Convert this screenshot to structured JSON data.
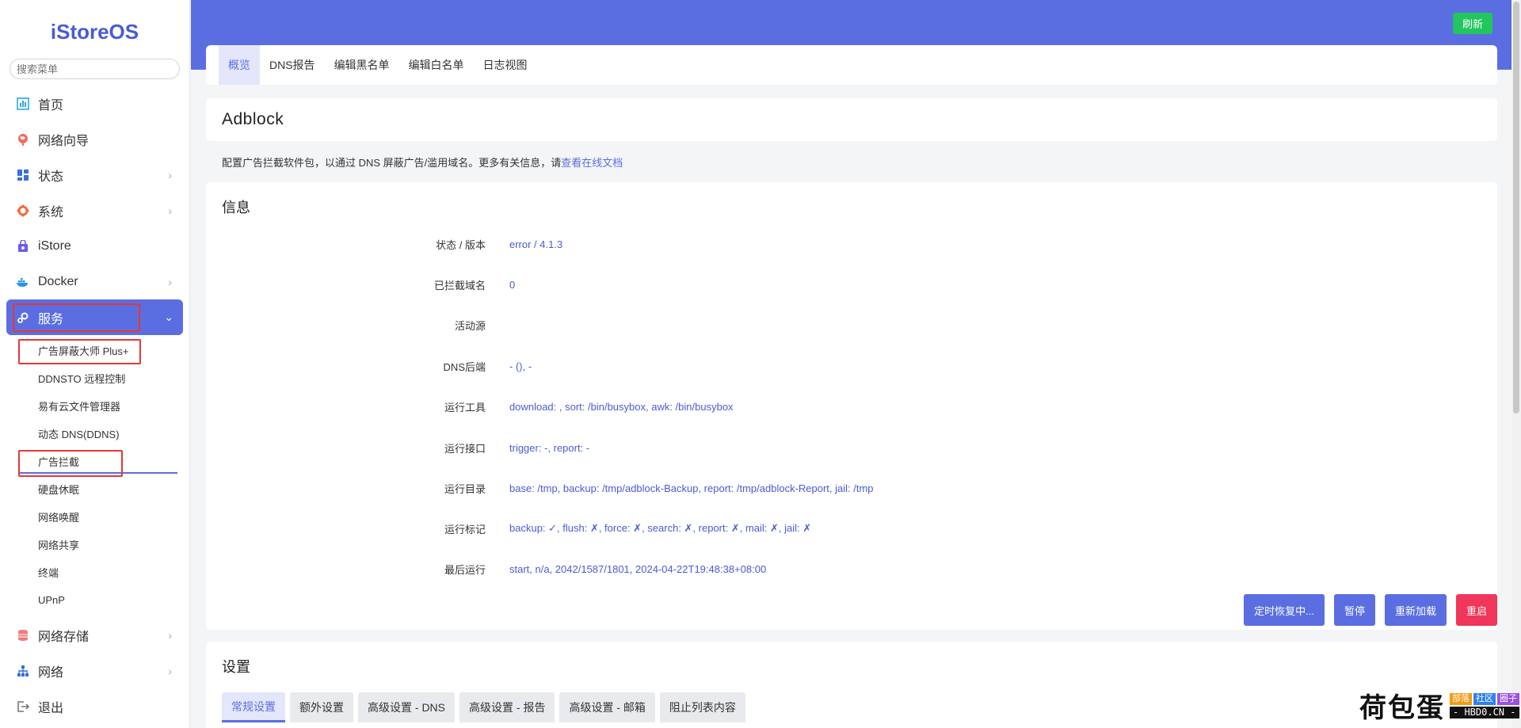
{
  "app": {
    "brand": "iStoreOS"
  },
  "search": {
    "placeholder": "搜索菜单"
  },
  "sidebar": {
    "items": [
      {
        "label": "首页",
        "icon": "dashboard-icon"
      },
      {
        "label": "网络向导",
        "icon": "globe-icon"
      },
      {
        "label": "状态",
        "icon": "status-icon",
        "chevron": "›"
      },
      {
        "label": "系统",
        "icon": "gear-icon",
        "chevron": "›"
      },
      {
        "label": "iStore",
        "icon": "store-icon"
      },
      {
        "label": "Docker",
        "icon": "docker-icon",
        "chevron": "›"
      },
      {
        "label": "服务",
        "icon": "services-icon",
        "chevron": "⌄"
      }
    ],
    "sub_items": [
      "广告屏蔽大师 Plus+",
      "DDNSTO 远程控制",
      "易有云文件管理器",
      "动态 DNS(DDNS)",
      "广告拦截",
      "硬盘休眠",
      "网络唤醒",
      "网络共享",
      "终端",
      "UPnP"
    ],
    "bottom_items": [
      {
        "label": "网络存储",
        "icon": "storage-icon",
        "chevron": "›"
      },
      {
        "label": "网络",
        "icon": "network-icon",
        "chevron": "›"
      },
      {
        "label": "退出",
        "icon": "logout-icon"
      }
    ]
  },
  "header": {
    "refresh_label": "刷新"
  },
  "tabs": [
    "概览",
    "DNS报告",
    "编辑黑名单",
    "编辑白名单",
    "日志视图"
  ],
  "page": {
    "title": "Adblock",
    "description": "配置广告拦截软件包，以通过 DNS 屏蔽广告/滥用域名。更多有关信息，请",
    "doc_link": "查看在线文档"
  },
  "info": {
    "heading": "信息",
    "rows": [
      {
        "label": "状态 / 版本",
        "value": "error / 4.1.3"
      },
      {
        "label": "已拦截域名",
        "value": "0"
      },
      {
        "label": "活动源",
        "value": ""
      },
      {
        "label": "DNS后端",
        "value": "- (), -"
      },
      {
        "label": "运行工具",
        "value": "download: , sort: /bin/busybox, awk: /bin/busybox"
      },
      {
        "label": "运行接口",
        "value": "trigger: -, report: -"
      },
      {
        "label": "运行目录",
        "value": "base: /tmp, backup: /tmp/adblock-Backup, report: /tmp/adblock-Report, jail: /tmp"
      },
      {
        "label": "运行标记",
        "value": "backup: ✓, flush: ✗, force: ✗, search: ✗, report: ✗, mail: ✗, jail: ✗"
      },
      {
        "label": "最后运行",
        "value": "start, n/a, 2042/1587/1801, 2024-04-22T19:48:38+08:00"
      }
    ],
    "buttons": {
      "resume": "定时恢复中...",
      "pause": "暂停",
      "reload": "重新加载",
      "restart": "重启"
    }
  },
  "settings": {
    "heading": "设置",
    "tabs": [
      "常规设置",
      "额外设置",
      "高级设置 - DNS",
      "高级设置 - 报告",
      "高级设置 - 邮箱",
      "阻止列表内容"
    ]
  },
  "watermark": {
    "text": "荷包蛋",
    "tags": [
      "部落",
      "社区",
      "圈子"
    ],
    "site": "- HBD0.CN -"
  },
  "colors": {
    "accent": "#5b6ee1",
    "refresh": "#22c55e",
    "danger": "#f0365a",
    "highlight_box": "#e53935"
  }
}
